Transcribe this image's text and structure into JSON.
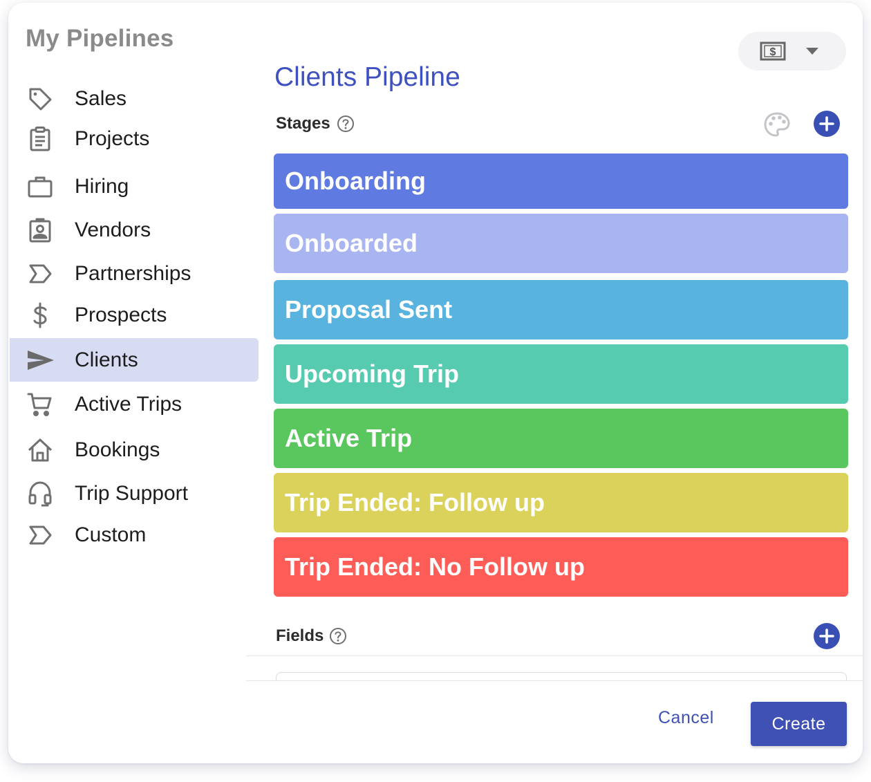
{
  "sidebar": {
    "title": "My Pipelines",
    "items": [
      {
        "label": "Sales",
        "icon": "tag-icon"
      },
      {
        "label": "Projects",
        "icon": "clipboard-icon"
      },
      {
        "label": "Hiring",
        "icon": "briefcase-icon"
      },
      {
        "label": "Vendors",
        "icon": "contact-badge-icon"
      },
      {
        "label": "Partnerships",
        "icon": "label-arrow-icon"
      },
      {
        "label": "Prospects",
        "icon": "dollar-icon"
      },
      {
        "label": "Clients",
        "icon": "send-icon",
        "active": true
      },
      {
        "label": "Active Trips",
        "icon": "cart-icon"
      },
      {
        "label": "Bookings",
        "icon": "home-icon"
      },
      {
        "label": "Trip Support",
        "icon": "headset-icon"
      },
      {
        "label": "Custom",
        "icon": "label-arrow-icon"
      }
    ]
  },
  "header": {
    "currency_icon": "money-icon",
    "dropdown_icon": "caret-down-icon"
  },
  "main": {
    "title": "Clients Pipeline",
    "stages_label": "Stages",
    "fields_label": "Fields",
    "stages": [
      {
        "label": "Onboarding",
        "color": "#5f7ae0"
      },
      {
        "label": "Onboarded",
        "color": "#a8b5f1"
      },
      {
        "label": "Proposal Sent",
        "color": "#58b3df"
      },
      {
        "label": "Upcoming Trip",
        "color": "#57cbb0"
      },
      {
        "label": "Active Trip",
        "color": "#5ac65e"
      },
      {
        "label": "Trip Ended: Follow up",
        "color": "#dbd25c"
      },
      {
        "label": "Trip Ended: No Follow up",
        "color": "#fe5c56"
      }
    ]
  },
  "footer": {
    "cancel_label": "Cancel",
    "create_label": "Create"
  },
  "colors": {
    "accent": "#3f51b5",
    "title": "#3f51c0",
    "active_nav": "#d7dcf3"
  }
}
